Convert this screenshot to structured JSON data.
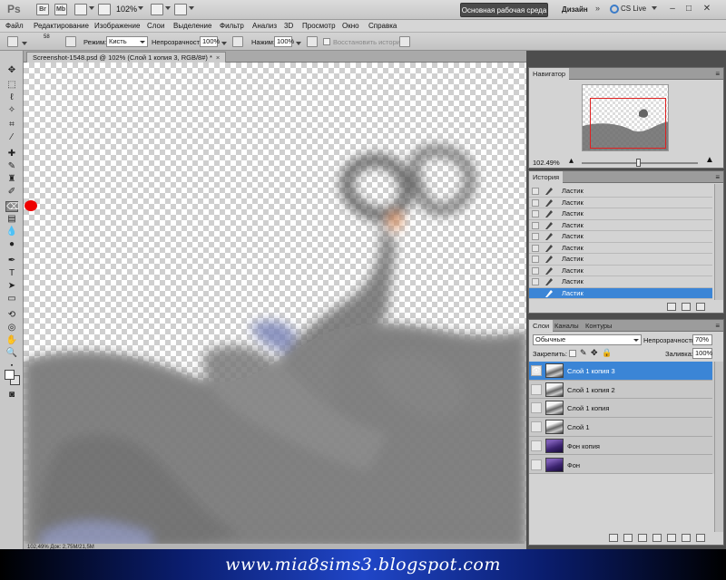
{
  "appbar": {
    "logo": "Ps",
    "bridge": "Br",
    "minibridge": "Mb",
    "zoom": "102%",
    "workspace_main": "Основная рабочая среда",
    "workspace_design": "Дизайн",
    "workspace_more": "»",
    "cs_live": "CS Live",
    "min": "–",
    "max": "□",
    "close": "✕"
  },
  "menu": [
    "Файл",
    "Редактирование",
    "Изображение",
    "Слои",
    "Выделение",
    "Фильтр",
    "Анализ",
    "3D",
    "Просмотр",
    "Окно",
    "Справка"
  ],
  "options": {
    "brush_size": "58",
    "mode_label": "Режим:",
    "mode_value": "Кисть",
    "opacity_label": "Непрозрачность:",
    "opacity_value": "100%",
    "flow_label": "Нажим:",
    "flow_value": "100%",
    "restore_history": "Восстановить историю"
  },
  "document": {
    "tab_title": "Screenshot-1548.psd @ 102% (Слой 1 копия 3, RGB/8#) *",
    "close": "×",
    "status": "102,49%    Док: 2,75М/21,5М"
  },
  "navigator": {
    "tab": "Навигатор",
    "zoom": "102.49%"
  },
  "history": {
    "tab": "История",
    "items": [
      "Ластик",
      "Ластик",
      "Ластик",
      "Ластик",
      "Ластик",
      "Ластик",
      "Ластик",
      "Ластик",
      "Ластик",
      "Ластик"
    ],
    "selected": "Ластик"
  },
  "layers": {
    "tabs": [
      "Слои",
      "Каналы",
      "Контуры"
    ],
    "blend_mode": "Обычные",
    "opacity_label": "Непрозрачность:",
    "opacity_value": "70%",
    "lock_label": "Закрепить:",
    "fill_label": "Заливка:",
    "fill_value": "100%",
    "items": [
      {
        "name": "Слой 1 копия 3",
        "selected": true,
        "visible": true,
        "thumb": "pic"
      },
      {
        "name": "Слой 1 копия 2",
        "selected": false,
        "visible": false,
        "thumb": "pic"
      },
      {
        "name": "Слой 1 копия",
        "selected": false,
        "visible": false,
        "thumb": "pic"
      },
      {
        "name": "Слой 1",
        "selected": false,
        "visible": false,
        "thumb": "pic"
      },
      {
        "name": "Фон копия",
        "selected": false,
        "visible": false,
        "thumb": "purple"
      },
      {
        "name": "Фон",
        "selected": false,
        "visible": false,
        "thumb": "purple"
      }
    ]
  },
  "banner": {
    "text": "www.mia8sims3.blogspot.com"
  },
  "colors": {
    "accent": "#3b85d6",
    "marker": "#ee0000",
    "banner": "#2046c8"
  }
}
